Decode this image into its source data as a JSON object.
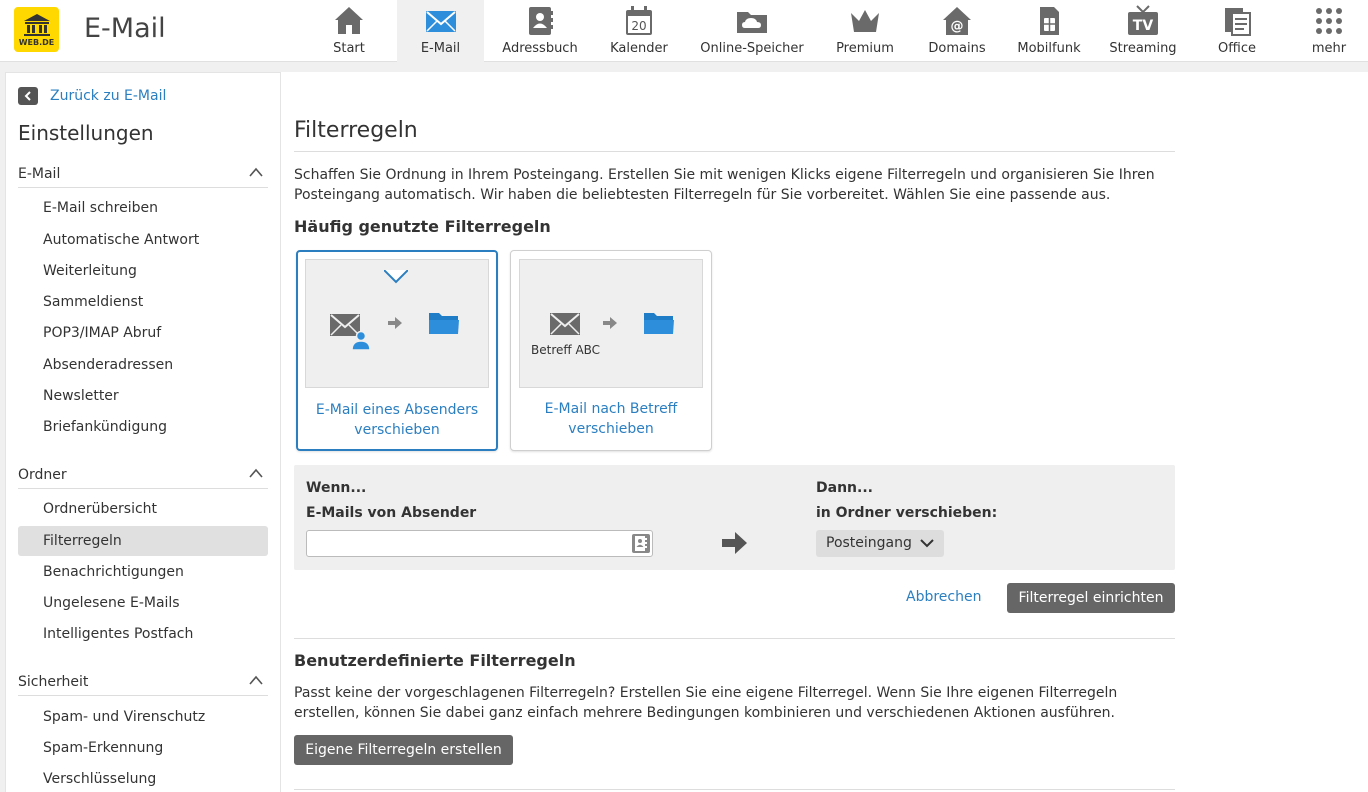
{
  "header": {
    "logo_text": "WEB.DE",
    "app_title": "E-Mail",
    "nav": [
      {
        "label": "Start",
        "icon": "home-icon"
      },
      {
        "label": "E-Mail",
        "icon": "envelope-icon",
        "active": true
      },
      {
        "label": "Adressbuch",
        "icon": "address-book-icon"
      },
      {
        "label": "Kalender",
        "icon": "calendar-icon",
        "icon_text": "20"
      },
      {
        "label": "Online-Speicher",
        "icon": "cloud-folder-icon"
      },
      {
        "label": "Premium",
        "icon": "crown-icon"
      },
      {
        "label": "Domains",
        "icon": "at-home-icon"
      },
      {
        "label": "Mobilfunk",
        "icon": "sim-card-icon"
      },
      {
        "label": "Streaming",
        "icon": "tv-icon",
        "icon_text": "TV"
      },
      {
        "label": "Office",
        "icon": "office-document-icon"
      },
      {
        "label": "mehr",
        "icon": "grid-dots-icon"
      }
    ]
  },
  "sidebar": {
    "back_label": "Zurück zu E-Mail",
    "title": "Einstellungen",
    "sections": [
      {
        "label": "E-Mail",
        "items": [
          "E-Mail schreiben",
          "Automatische Antwort",
          "Weiterleitung",
          "Sammeldienst",
          "POP3/IMAP Abruf",
          "Absenderadressen",
          "Newsletter",
          "Briefankündigung"
        ]
      },
      {
        "label": "Ordner",
        "items": [
          "Ordnerübersicht",
          "Filterregeln",
          "Benachrichtigungen",
          "Ungelesene E-Mails",
          "Intelligentes Postfach"
        ]
      },
      {
        "label": "Sicherheit",
        "items": [
          "Spam- und Virenschutz",
          "Spam-Erkennung",
          "Verschlüsselung"
        ]
      }
    ],
    "selected_item": "Filterregeln"
  },
  "main": {
    "title": "Filterregeln",
    "intro": "Schaffen Sie Ordnung in Ihrem Posteingang. Erstellen Sie mit wenigen Klicks eigene Filterregeln und organisieren Sie Ihren Posteingang automatisch. Wir haben die beliebtesten Filterregeln für Sie vorbereitet. Wählen Sie eine passende aus.",
    "common_heading": "Häufig genutzte Filterregeln",
    "cards": [
      {
        "label": "E-Mail eines Absenders verschieben",
        "selected": true
      },
      {
        "label": "E-Mail nach Betreff verschieben",
        "sublabel": "Betreff ABC",
        "selected": false
      }
    ],
    "filter": {
      "if_label": "Wenn...",
      "if_sub": "E-Mails von Absender",
      "sender_value": "",
      "then_label": "Dann...",
      "then_sub": "in Ordner verschieben:",
      "folder_value": "Posteingang"
    },
    "cancel_label": "Abbrechen",
    "submit_label": "Filterregel einrichten",
    "custom_heading": "Benutzerdefinierte Filterregeln",
    "custom_text": "Passt keine der vorgeschlagenen Filterregeln? Erstellen Sie eine eigene Filterregel. Wenn Sie Ihre eigenen Filterregeln erstellen, können Sie dabei ganz einfach mehrere Bedingungen kombinieren und verschiedenen Aktionen ausführen.",
    "custom_button": "Eigene Filterregeln erstellen"
  },
  "colors": {
    "accent": "#2b7fc1",
    "logo": "#ffd800",
    "icon_gray": "#6a6a6a",
    "folder_blue": "#2d8fdc"
  }
}
